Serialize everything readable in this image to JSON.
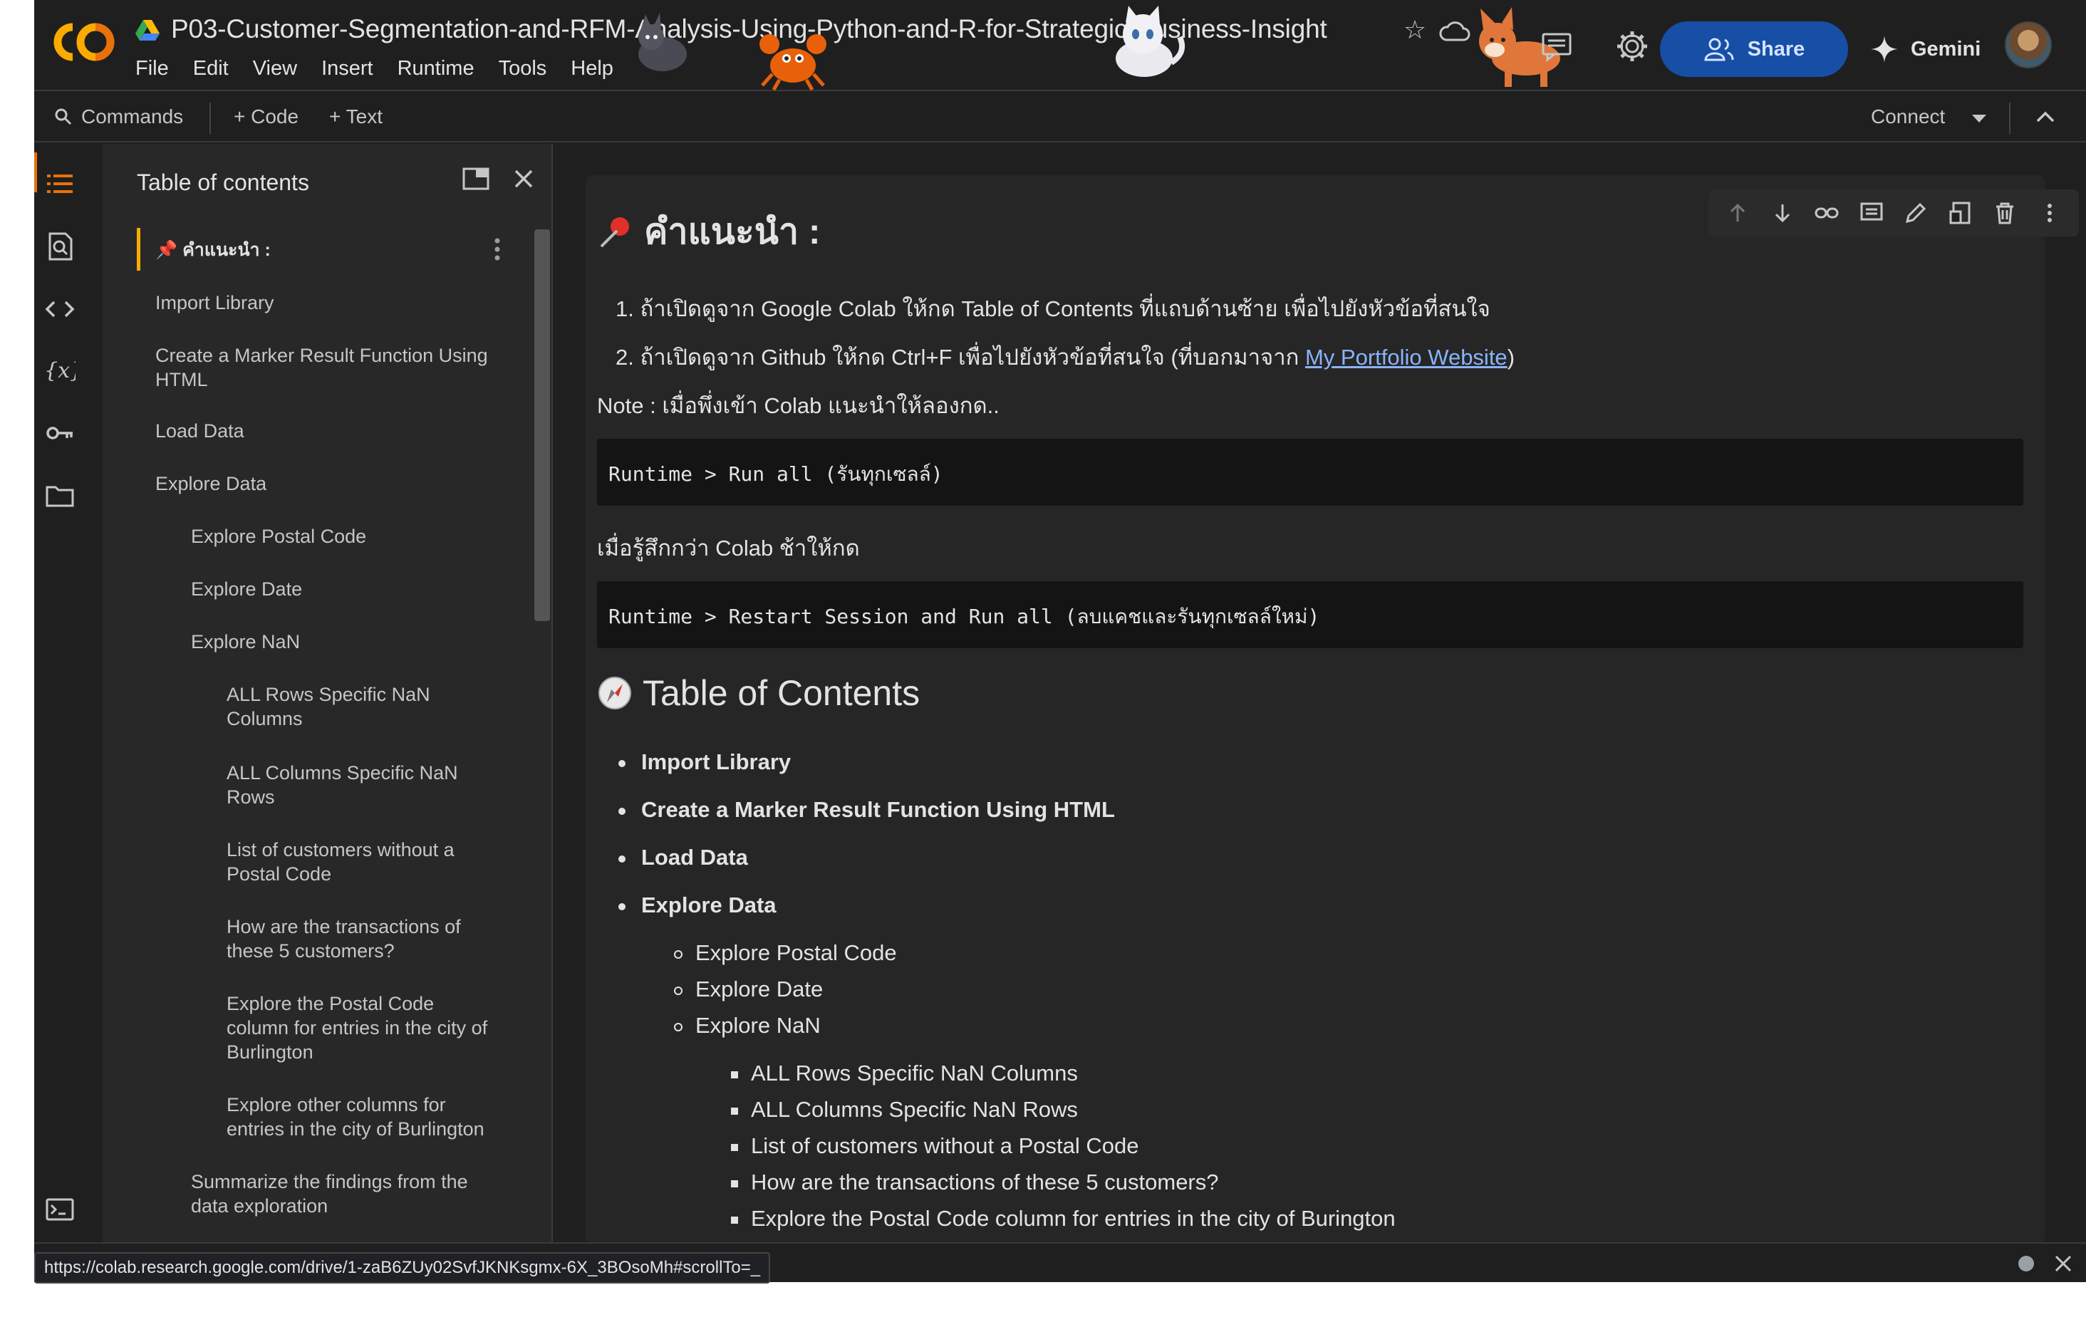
{
  "app": {
    "title": "P03-Customer-Segmentation-and-RFM-Analysis-Using-Python-and-R-for-Strategic-Business-Insight",
    "menu": [
      "File",
      "Edit",
      "View",
      "Insert",
      "Runtime",
      "Tools",
      "Help"
    ],
    "share_label": "Share",
    "gemini_label": "Gemini"
  },
  "toolbar": {
    "commands_label": "Commands",
    "code_label": "+ Code",
    "text_label": "+ Text",
    "connect_label": "Connect"
  },
  "toc": {
    "heading": "Table of contents",
    "items": [
      {
        "label": "📌 คำแนะนำ :"
      },
      {
        "label": "Import Library"
      },
      {
        "label": "Create a Marker Result Function Using HTML"
      },
      {
        "label": "Load Data"
      },
      {
        "label": "Explore Data"
      },
      {
        "label": "Explore Postal Code"
      },
      {
        "label": "Explore Date"
      },
      {
        "label": "Explore NaN"
      },
      {
        "label": "ALL Rows Specific NaN Columns"
      },
      {
        "label": "ALL Columns Specific NaN Rows"
      },
      {
        "label": "List of customers without a Postal Code"
      },
      {
        "label": "How are the transactions of these 5 customers?"
      },
      {
        "label": "Explore the Postal Code column for entries in the city of Burlington"
      },
      {
        "label": "Explore other columns for entries in the city of Burlington"
      },
      {
        "label": "Summarize the findings from the data exploration"
      }
    ]
  },
  "notebook": {
    "heading1": "คำแนะนำ :",
    "step1": "1. ถ้าเปิดดูจาก Google Colab ให้กด Table of Contents ที่แถบด้านซ้าย เพื่อไปยังหัวข้อที่สนใจ",
    "step2_prefix": "2. ถ้าเปิดดูจาก Github ให้กด Ctrl+F เพื่อไปยังหัวข้อที่สนใจ (ที่บอกมาจาก ",
    "step2_link": "My Portfolio Website",
    "step2_suffix": ")",
    "note": "Note : เมื่อพึ่งเข้า Colab แนะนำให้ลองกด..",
    "code1": "Runtime > Run all (รันทุกเซลล์)",
    "slow_note": "เมื่อรู้สึกกว่า Colab ช้าให้กด",
    "code2": "Runtime > Restart Session and Run all (ลบแคชและรันทุกเซลล์ใหม่)",
    "heading2": "Table of Contents",
    "toc_bullets": [
      "Import Library",
      "Create a Marker Result Function Using HTML",
      "Load Data",
      "Explore Data"
    ],
    "sub_bullets": [
      "Explore Postal Code",
      "Explore Date",
      "Explore NaN"
    ],
    "subsub_bullets": [
      "ALL Rows Specific NaN Columns",
      "ALL Columns Specific NaN Rows",
      "List of customers without a Postal Code",
      "How are the transactions of these 5 customers?",
      "Explore the Postal Code column for entries in the city of Burington"
    ]
  },
  "status": {
    "url": "https://colab.research.google.com/drive/1-zaB6ZUy02SvfJKNKsgmx-6X_3BOsoMh#scrollTo=_"
  },
  "colors": {
    "accent_orange": "#e8710a",
    "share_bg": "#174ea6",
    "link": "#8ab4f8"
  }
}
